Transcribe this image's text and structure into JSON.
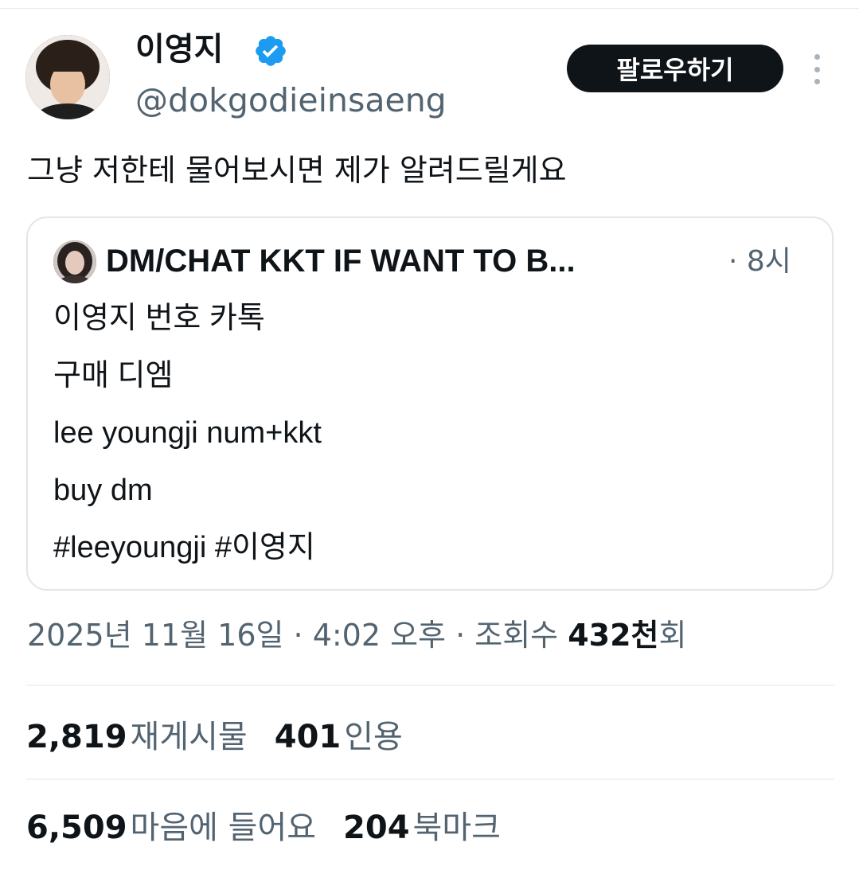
{
  "author": {
    "display_name": "이영지",
    "handle": "@dokgodieinsaeng",
    "verified_icon": "verified-badge-icon",
    "follow_label": "팔로우하기"
  },
  "tweet": {
    "text": "그냥 저한테 물어보시면 제가 알려드릴게요"
  },
  "quote": {
    "author_name": "DM/CHAT KKT IF WANT TO B...",
    "time": "· 8시",
    "lines": [
      "이영지 번호 카톡",
      "구매 디엠",
      "lee youngji num+kkt",
      "buy dm",
      "#leeyoungji #이영지"
    ]
  },
  "meta": {
    "timestamp": "2025년 11월 16일 · 4:02 오후 · 조회수 ",
    "views_count": "432천",
    "views_suffix": "회"
  },
  "stats": {
    "reposts_count": "2,819",
    "reposts_label": "재게시물",
    "quotes_count": "401",
    "quotes_label": "인용",
    "likes_count": "6,509",
    "likes_label": "마음에 들어요",
    "bookmarks_count": "204",
    "bookmarks_label": "북마크"
  },
  "colors": {
    "verified_blue": "#1d9bf0",
    "secondary_text": "#536471",
    "primary_text": "#0f1419"
  }
}
